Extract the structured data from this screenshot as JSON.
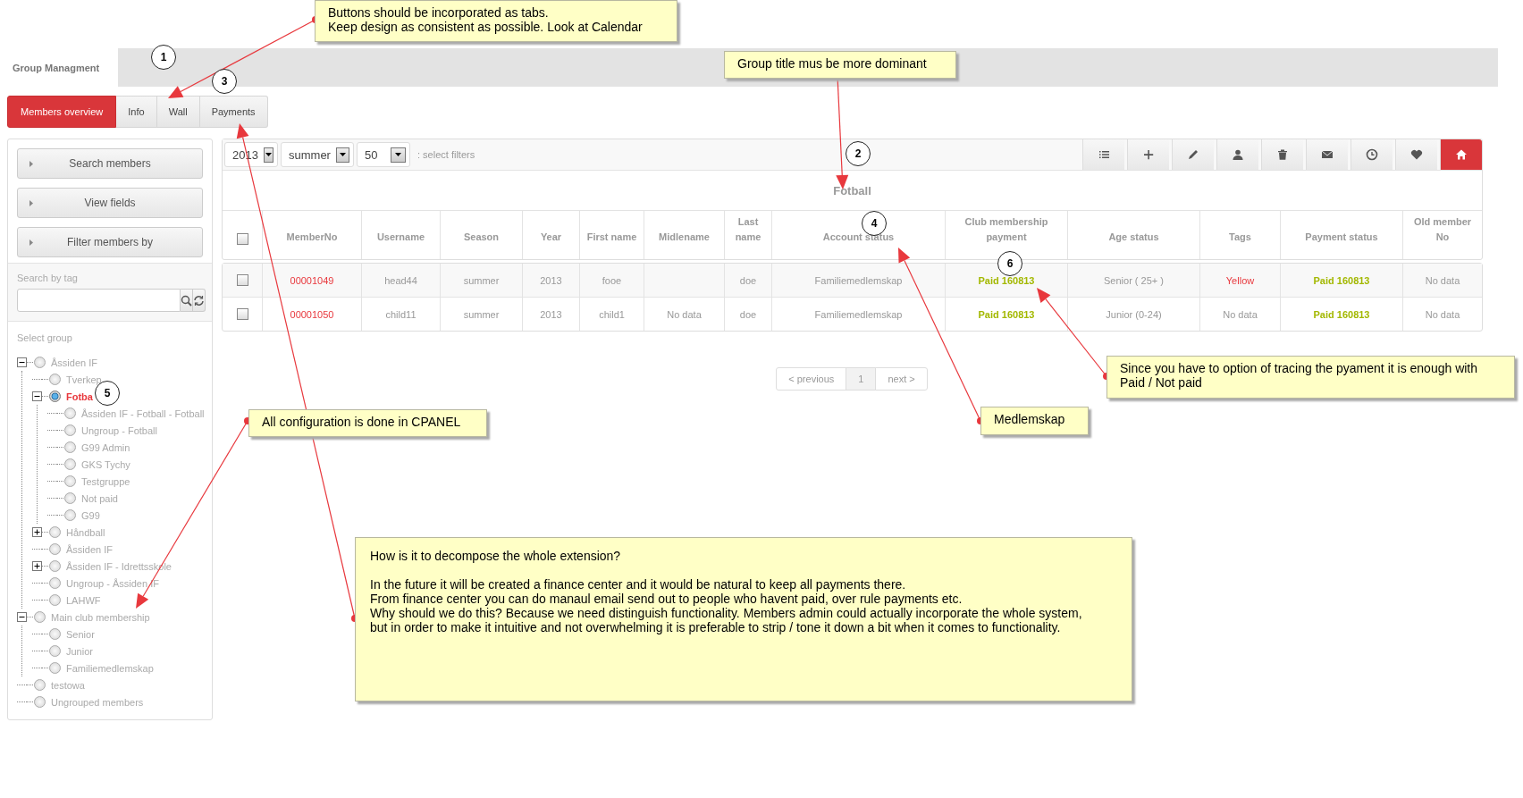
{
  "header": {
    "title": "Group Managment"
  },
  "tabs": [
    {
      "label": "Members overview",
      "selected": true
    },
    {
      "label": "Info",
      "selected": false
    },
    {
      "label": "Wall",
      "selected": false
    },
    {
      "label": "Payments",
      "selected": false
    }
  ],
  "sidebar": {
    "buttons": [
      "Search members",
      "View fields",
      "Filter members by"
    ],
    "tag_search": {
      "label": "Search by tag"
    },
    "group_tree": {
      "label": "Select group",
      "items": [
        {
          "label": "Åssiden IF",
          "selected": false,
          "expanded": true,
          "children": [
            {
              "label": "Tverkep",
              "selected": false
            },
            {
              "label": "Fotba",
              "selected": true,
              "expanded": true,
              "children": [
                {
                  "label": "Åssiden IF - Fotball - Fotball",
                  "selected": false
                },
                {
                  "label": "Ungroup - Fotball",
                  "selected": false
                },
                {
                  "label": "G99 Admin",
                  "selected": false
                },
                {
                  "label": "GKS Tychy",
                  "selected": false
                },
                {
                  "label": "Testgruppe",
                  "selected": false
                },
                {
                  "label": "Not paid",
                  "selected": false
                },
                {
                  "label": "G99",
                  "selected": false
                }
              ]
            },
            {
              "label": "Håndball",
              "selected": false,
              "expanded": false
            },
            {
              "label": "Åssiden IF",
              "selected": false
            },
            {
              "label": "Åssiden IF - Idrettsskole",
              "selected": false,
              "expanded": false
            },
            {
              "label": "Ungroup - Åssiden IF",
              "selected": false
            },
            {
              "label": "LAHWF",
              "selected": false
            }
          ]
        },
        {
          "label": "Main club membership",
          "selected": false,
          "expanded": true,
          "children": [
            {
              "label": "Senior",
              "selected": false
            },
            {
              "label": "Junior",
              "selected": false
            },
            {
              "label": "Familiemedlemskap",
              "selected": false
            }
          ]
        },
        {
          "label": "testowa",
          "selected": false
        },
        {
          "label": "Ungrouped members",
          "selected": false
        }
      ]
    }
  },
  "filters": {
    "year": "2013",
    "season": "summer",
    "page_size": "50",
    "hint": ": select filters"
  },
  "toolbar": [
    {
      "selected": false
    },
    {
      "selected": false
    },
    {
      "selected": false
    },
    {
      "selected": false
    },
    {
      "selected": false
    },
    {
      "selected": false
    },
    {
      "selected": false
    },
    {
      "selected": false
    },
    {
      "selected": true
    }
  ],
  "table": {
    "title": "Fotball",
    "all_selected": false,
    "columns": [
      {
        "label": "MemberNo",
        "kind": "id"
      },
      {
        "label": "Username",
        "kind": "text"
      },
      {
        "label": "Season",
        "kind": "text"
      },
      {
        "label": "Year",
        "kind": "text"
      },
      {
        "label": "First name",
        "kind": "text"
      },
      {
        "label": "Midlename",
        "kind": "text"
      },
      {
        "label": "Last name",
        "kind": "text"
      },
      {
        "label": "Account status",
        "kind": "text"
      },
      {
        "label": "Club membership payment",
        "kind": "paid"
      },
      {
        "label": "Age status",
        "kind": "text"
      },
      {
        "label": "Tags",
        "kind": "tag"
      },
      {
        "label": "Payment status",
        "kind": "paid"
      },
      {
        "label": "Old member No",
        "kind": "text"
      }
    ],
    "rows": [
      {
        "selected": false,
        "cells": [
          "00001049",
          "head44",
          "summer",
          "2013",
          "fooe",
          null,
          "doe",
          "Familiemedlemskap",
          "Paid 160813",
          "Senior ( 25+ )",
          {
            "text": "Yellow",
            "color": "#e8383d"
          },
          "Paid 160813",
          "No data"
        ]
      },
      {
        "selected": false,
        "cells": [
          "00001050",
          "child11",
          "summer",
          "2013",
          "child1",
          "No data",
          "doe",
          "Familiemedlemskap",
          "Paid 160813",
          "Junior (0-24)",
          "No data",
          "Paid 160813",
          "No data"
        ]
      }
    ]
  },
  "pagination": {
    "previous": "< previous",
    "pages": [
      {
        "label": "1",
        "selected": true
      }
    ],
    "next": "next >"
  },
  "annotations": {
    "notes": [
      {
        "text": "Buttons should be incorporated as tabs.\nKeep design as consistent as possible. Look at Calendar"
      },
      {
        "text": "Group title mus be more dominant"
      },
      {
        "text": "All configuration is done in CPANEL"
      },
      {
        "text": "Medlemskap"
      },
      {
        "text": "Since you have to option of tracing the pyament it is enough with\nPaid / Not paid"
      },
      {
        "text": "How is it to decompose the whole extension?\n\nIn the future it will be created a finance center and it would be natural to keep all payments there.\nFrom finance center you can do manaul email send out to people who havent paid, over rule payments etc.\nWhy should we do this? Because we need distinguish functionality. Members admin could actually incorporate the whole system,\nbut in order to make it intuitive and not overwhelming it is preferable to strip / tone it down a bit when it comes to functionality."
      }
    ],
    "markers": [
      {
        "label": "1"
      },
      {
        "label": "2"
      },
      {
        "label": "3"
      },
      {
        "label": "4"
      },
      {
        "label": "5"
      },
      {
        "label": "6"
      }
    ]
  }
}
